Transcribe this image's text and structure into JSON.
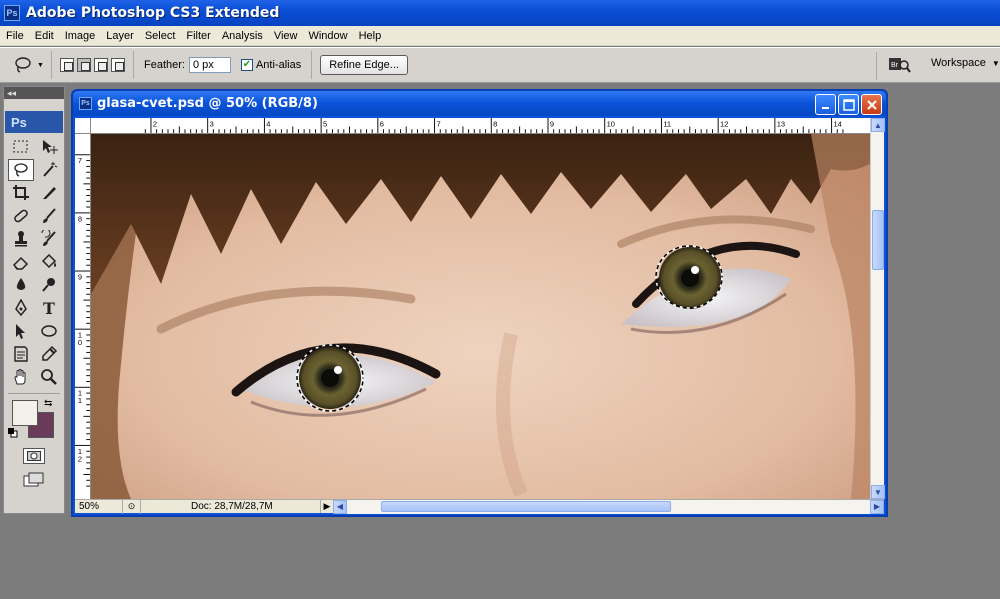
{
  "app": {
    "badge": "Ps",
    "title": "Adobe Photoshop CS3 Extended"
  },
  "menu": [
    "File",
    "Edit",
    "Image",
    "Layer",
    "Select",
    "Filter",
    "Analysis",
    "View",
    "Window",
    "Help"
  ],
  "options": {
    "feather_label": "Feather:",
    "feather_value": "0 px",
    "antialias_label": "Anti-alias",
    "antialias_checked": true,
    "refine_label": "Refine Edge...",
    "workspace_label": "Workspace"
  },
  "toolbox": {
    "collapse_glyph": "◂◂",
    "badge": "Ps",
    "tools": [
      "rectangular-marquee",
      "move",
      "lasso",
      "magic-wand",
      "crop",
      "slice",
      "spot-healing-brush",
      "brush",
      "clone-stamp",
      "history-brush",
      "eraser",
      "paint-bucket",
      "blur",
      "dodge",
      "pen",
      "type",
      "path-selection",
      "ellipse",
      "notes",
      "eyedropper",
      "hand",
      "zoom"
    ],
    "active_tool": "lasso",
    "foreground_color": "#f4f1ea",
    "background_color": "#6a3a5a"
  },
  "document": {
    "badge": "Ps",
    "title": "glasa-cvet.psd @ 50% (RGB/8)",
    "zoom": "50%",
    "doc_info": "Doc: 28,7M/28,7M",
    "ruler_h": [
      "2",
      "3",
      "4",
      "5",
      "6",
      "7",
      "8",
      "9",
      "10",
      "11",
      "12",
      "13",
      "14"
    ],
    "ruler_v": [
      "7",
      "8",
      "9",
      "1\n0",
      "1\n1",
      "1\n2"
    ]
  }
}
